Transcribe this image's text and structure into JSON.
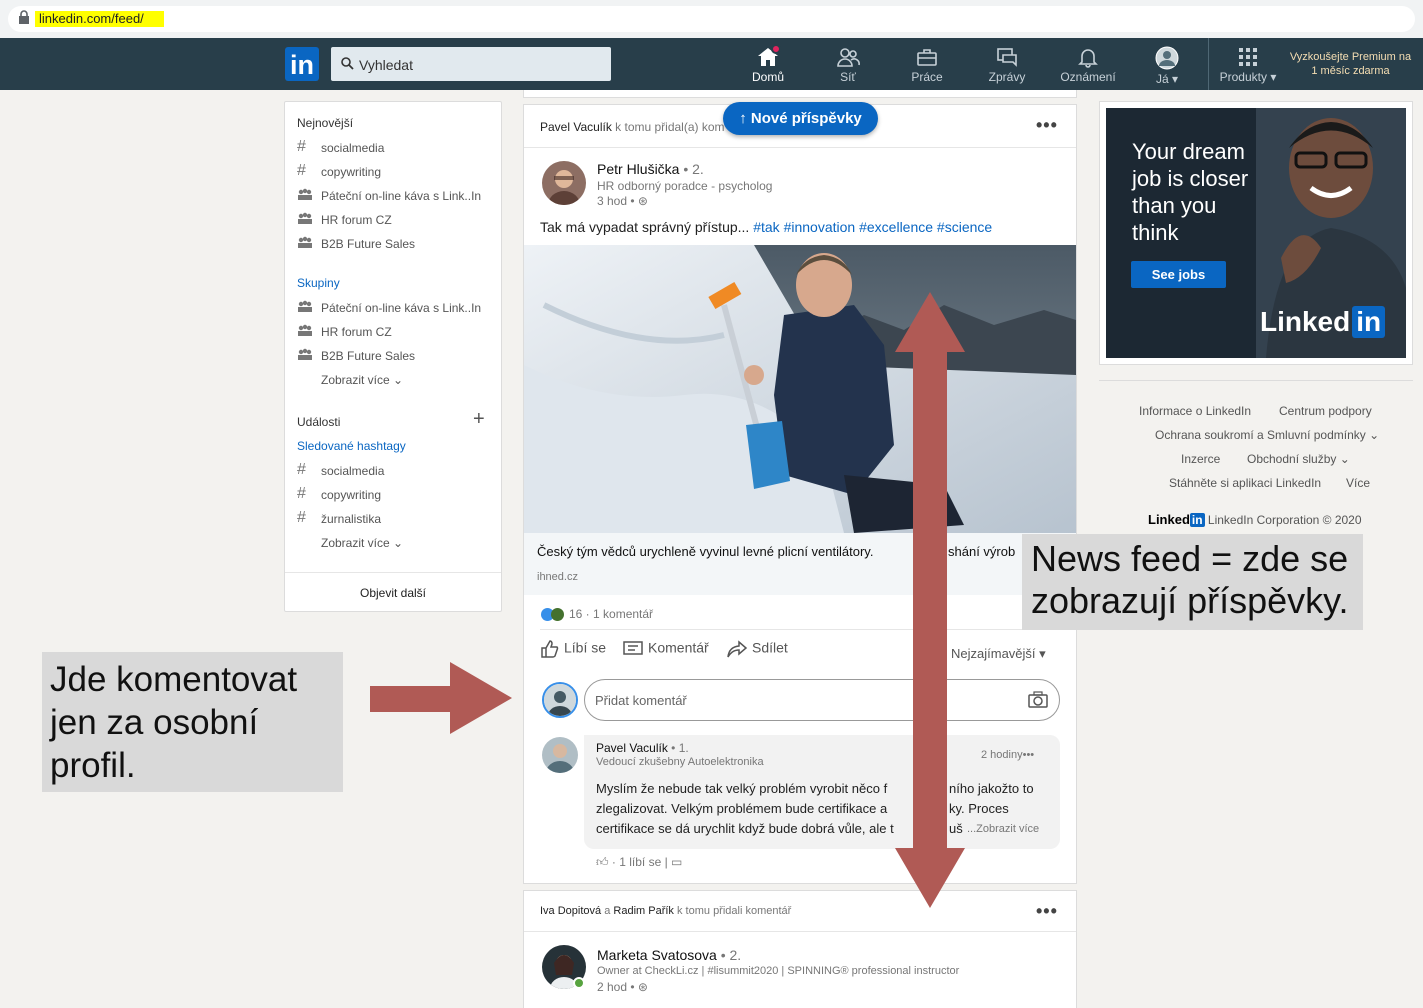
{
  "browser": {
    "url": "linkedin.com/feed/"
  },
  "nav": {
    "search_placeholder": "Vyhledat",
    "items": [
      {
        "label": "Domů",
        "icon": "home-icon"
      },
      {
        "label": "Síť",
        "icon": "network-icon"
      },
      {
        "label": "Práce",
        "icon": "briefcase-icon"
      },
      {
        "label": "Zprávy",
        "icon": "messages-icon"
      },
      {
        "label": "Oznámení",
        "icon": "bell-icon"
      },
      {
        "label": "Já",
        "icon": "avatar"
      },
      {
        "label": "Produkty",
        "icon": "grid-icon"
      }
    ],
    "premium": "Vyzkoušejte Premium na 1 měsíc zdarma"
  },
  "sidebar": {
    "recent_title": "Nejnovější",
    "recent": [
      {
        "type": "hashtag",
        "label": "socialmedia"
      },
      {
        "type": "hashtag",
        "label": "copywriting"
      },
      {
        "type": "group",
        "label": "Páteční on-line káva s Link..In"
      },
      {
        "type": "group",
        "label": "HR forum CZ"
      },
      {
        "type": "group",
        "label": "B2B Future Sales"
      }
    ],
    "groups_title": "Skupiny",
    "groups": [
      {
        "label": "Páteční on-line káva s Link..In"
      },
      {
        "label": "HR forum CZ"
      },
      {
        "label": "B2B Future Sales"
      }
    ],
    "show_more": "Zobrazit více",
    "events_title": "Události",
    "hashtags_title": "Sledované hashtagy",
    "hashtags": [
      "socialmedia",
      "copywriting",
      "žurnalistika"
    ],
    "discover": "Objevit další"
  },
  "feed": {
    "new_posts": "Nové příspěvky",
    "post": {
      "context_name": "Pavel Vaculík",
      "context_text": "k tomu přidal(a) kom",
      "author": "Petr Hlušička",
      "degree": "• 2.",
      "headline": "HR odborný poradce - psycholog",
      "time": "3 hod •",
      "text": "Tak má vypadat správný přístup...",
      "hashtags": [
        "#tak",
        "#innovation",
        "#excellence",
        "#science"
      ],
      "link_title": "Český tým vědců urychleně vyvinul levné plicní ventilátory.",
      "link_title_tail": "shání výrob",
      "link_source": "ihned.cz",
      "reactions": "16 · 1 komentář",
      "actions": [
        "Líbí se",
        "Komentář",
        "Sdílet"
      ],
      "sort": "Nejzajímavější",
      "comment_placeholder": "Přidat komentář",
      "comment": {
        "author": "Pavel Vaculík",
        "degree": "• 1.",
        "headline": "Vedoucí zkušebny Autoelektronika",
        "time": "2 hodiny",
        "lines": [
          "Myslím že nebude tak velký problém vyrobit něco f",
          "zlegalizovat. Velkým problémem bude certifikace a",
          "certifikace se dá urychlit když bude dobrá vůle, ale t"
        ],
        "lines_tail": [
          "ního jakožto to",
          "ky. Proces",
          "uš"
        ],
        "more": "...Zobrazit více",
        "likes": "1 líbí se"
      }
    },
    "post2": {
      "context_names": "Iva Dopitová",
      "context_and": "a",
      "context_name2": "Radim Pařík",
      "context_text": "k tomu přidali komentář",
      "author": "Marketa Svatosova",
      "degree": "• 2.",
      "headline": "Owner at CheckLi.cz | #lisummit2020 | SPINNING® professional instructor",
      "time": "2 hod •"
    }
  },
  "ad": {
    "lines": [
      "Your dream",
      "job is closer",
      "than you",
      "think"
    ],
    "button": "See jobs",
    "logo": "Linked",
    "logo_in": "in"
  },
  "footer": {
    "links": [
      "Informace o LinkedIn",
      "Centrum podpory",
      "Ochrana soukromí a Smluvní podmínky",
      "Inzerce",
      "Obchodní služby",
      "Stáhněte si aplikaci LinkedIn",
      "Více"
    ],
    "corp_logo": "Linked",
    "corp_in": "in",
    "corp": "LinkedIn Corporation © 2020"
  },
  "annotations": {
    "left": "Jde komentovat jen za osobní profil.",
    "right": "News feed = zde se zobrazují příspěvky."
  },
  "colors": {
    "nav": "#283e4a",
    "brand": "#0a66c2",
    "arrow": "#b05a55",
    "note_bg": "#d9d9d9"
  }
}
